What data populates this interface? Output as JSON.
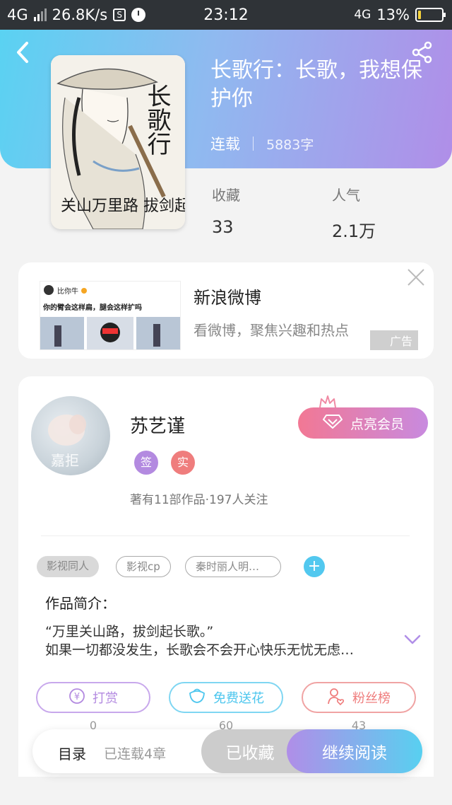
{
  "status_bar": {
    "network": "4G",
    "speed": "26.8K/s",
    "s_icon": "S",
    "time": "23:12",
    "network_right": "4G",
    "battery": "13%",
    "battery_level": 0.13
  },
  "book": {
    "title": "长歌行：长歌，我想保护你",
    "status": "连载",
    "word_count": "5883字",
    "favorites_label": "收藏",
    "favorites_value": "33",
    "popularity_label": "人气",
    "popularity_value": "2.1万",
    "cover_text_top": "长歌行",
    "cover_text_bottom": "关山万里路 拔剑起长歌"
  },
  "ad": {
    "name": "新浪微博",
    "description": "看微博，聚焦兴趣和热点",
    "tag": "广告",
    "image_user": "比你牛",
    "image_caption": "你的臂会这样扁，腿会这样扩吗"
  },
  "author": {
    "name": "苏艺谨",
    "badge_sign": "签",
    "badge_real": "实",
    "vip_button": "点亮会员",
    "stats": "著有11部作品·197人关注",
    "avatar_text": "嘉拒"
  },
  "tags": [
    "影视同人",
    "影视cp",
    "秦时丽人明…"
  ],
  "intro": {
    "title": "作品简介：",
    "text_line1": "“万里关山路，拔剑起长歌。”",
    "text_line2": "如果一切都没发生，长歌会不会开心快乐无忧无虑…"
  },
  "actions": [
    {
      "label": "打赏",
      "icon": "yen-icon",
      "count": "0",
      "color": "#b38ae0"
    },
    {
      "label": "免费送花",
      "icon": "flower-icon",
      "count": "60",
      "color": "#4cc6ee"
    },
    {
      "label": "粉丝榜",
      "icon": "fan-icon",
      "count": "43",
      "color": "#ef7d7d"
    }
  ],
  "bottom_bar": {
    "toc": "目录",
    "chapters": "已连载4章",
    "favorited": "已收藏",
    "continue": "继续阅读"
  },
  "colors": {
    "header_start": "#5ad2f2",
    "header_end": "#b08ee8",
    "sign_badge": "#b38ae0",
    "real_badge": "#ef7d7d",
    "plus": "#52c8ef"
  }
}
